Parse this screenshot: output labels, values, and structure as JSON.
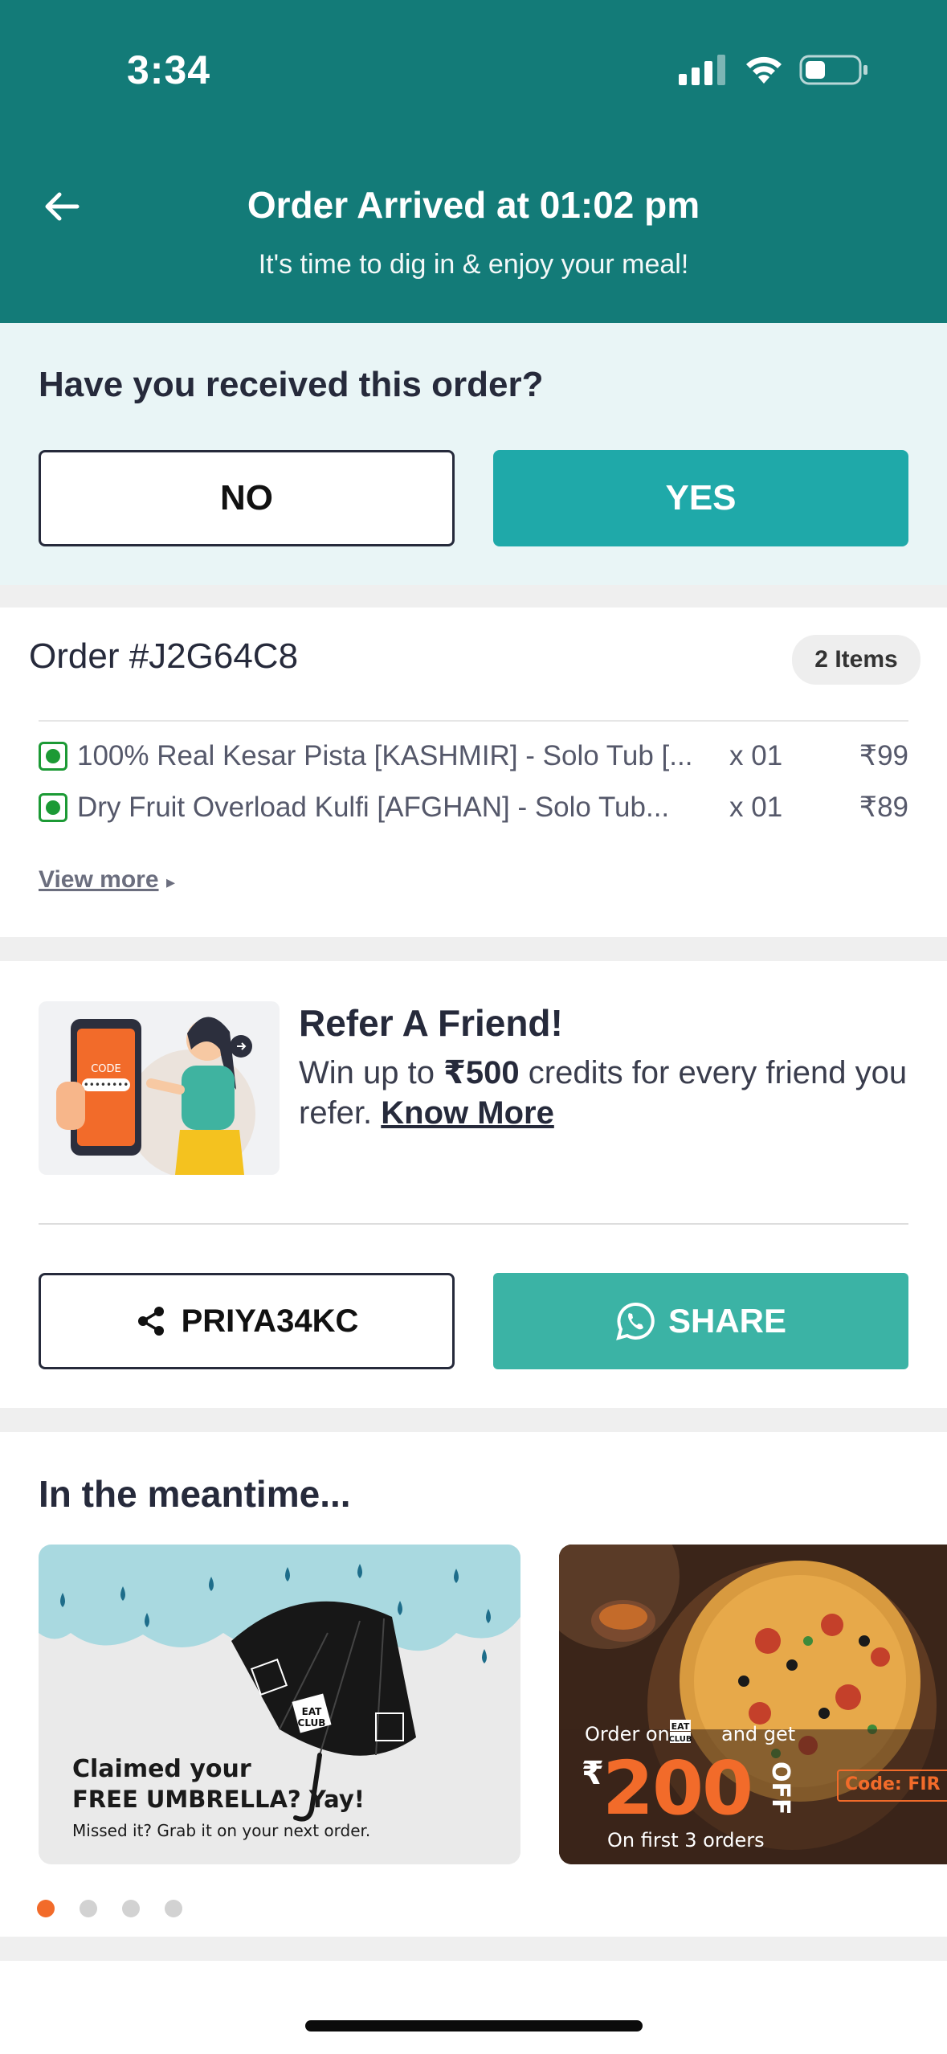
{
  "status_bar": {
    "time": "3:34"
  },
  "header": {
    "title": "Order Arrived at 01:02 pm",
    "subtitle": "It's time to dig in & enjoy your meal!"
  },
  "confirmation": {
    "question": "Have you received this order?",
    "no_label": "NO",
    "yes_label": "YES"
  },
  "order": {
    "id_label": "Order #J2G64C8",
    "items_count": "2 Items",
    "items": [
      {
        "name": "100% Real Kesar Pista [KASHMIR] - Solo Tub [...",
        "qty": "x 01",
        "price": "₹99"
      },
      {
        "name": "Dry Fruit Overload Kulfi [AFGHAN] - Solo Tub...",
        "qty": "x 01",
        "price": "₹89"
      }
    ],
    "view_more": "View more"
  },
  "refer": {
    "title": "Refer A Friend!",
    "desc_prefix": "Win up to ",
    "desc_amount": "₹500",
    "desc_suffix": " credits for every friend you refer. ",
    "know_more": "Know More",
    "illustration_code": "CODE",
    "referral_code": "PRIYA34KC",
    "share_label": "SHARE"
  },
  "meantime": {
    "title": "In the meantime...",
    "cards": [
      {
        "line1": "Claimed your",
        "line2": "FREE UMBRELLA? Yay!",
        "line3": "Missed it? Grab it on your next order.",
        "brand_top": "EAT",
        "brand_bottom": "CLUB"
      },
      {
        "line1_prefix": "Order on",
        "line1_suffix": "and get",
        "currency": "₹",
        "amount": "200",
        "off": "OFF",
        "line3": "On first 3 orders",
        "code": "Code: FIR",
        "brand_top": "EAT",
        "brand_bottom": "CLUB"
      }
    ],
    "carousel_active_index": 0,
    "carousel_count": 4
  },
  "colors": {
    "header_bg": "#137b78",
    "yes_button": "#1fa9a9",
    "share_button": "#3bb3a5",
    "veg_green": "#1c9a35",
    "active_dot": "#f26b2a"
  }
}
